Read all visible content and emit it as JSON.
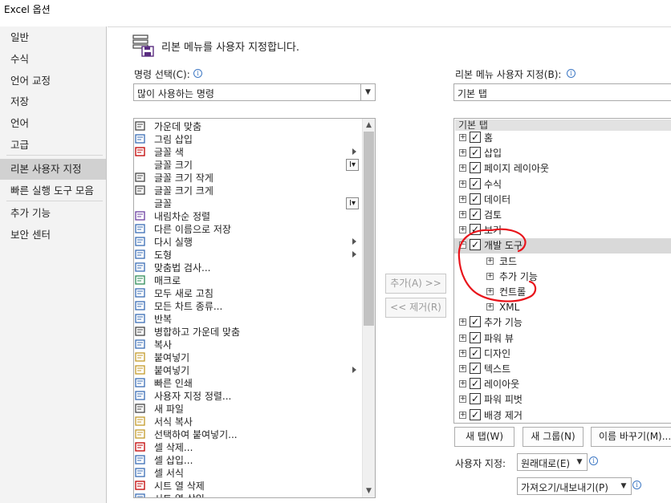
{
  "window": {
    "title": "Excel 옵션"
  },
  "sidebar": {
    "items": [
      {
        "label": "일반"
      },
      {
        "label": "수식"
      },
      {
        "label": "언어 교정"
      },
      {
        "label": "저장"
      },
      {
        "label": "언어"
      },
      {
        "label": "고급"
      },
      {
        "label": "리본 사용자 지정"
      },
      {
        "label": "빠른 실행 도구 모음"
      },
      {
        "label": "추가 기능"
      },
      {
        "label": "보안 센터"
      }
    ],
    "active_index": 6
  },
  "header": {
    "title": "리본 메뉴를 사용자 지정합니다."
  },
  "left": {
    "choose_label": "명령 선택(C):",
    "choose_value": "많이 사용하는 명령",
    "commands": [
      {
        "label": "가운데 맞춤",
        "icon": "center-align-icon"
      },
      {
        "label": "그림 삽입",
        "icon": "picture-icon"
      },
      {
        "label": "글꼴 색",
        "icon": "font-color-icon",
        "arrow": true
      },
      {
        "label": "글꼴 크기",
        "icon": "blank",
        "menu": true
      },
      {
        "label": "글꼴 크기 작게",
        "icon": "font-shrink-icon"
      },
      {
        "label": "글꼴 크기 크게",
        "icon": "font-grow-icon"
      },
      {
        "label": "글꼴",
        "icon": "blank",
        "menu": true
      },
      {
        "label": "내림차순 정렬",
        "icon": "sort-desc-icon"
      },
      {
        "label": "다른 이름으로 저장",
        "icon": "save-as-icon"
      },
      {
        "label": "다시 실행",
        "icon": "redo-icon",
        "arrow": true
      },
      {
        "label": "도형",
        "icon": "shapes-icon",
        "arrow": true
      },
      {
        "label": "맞춤법 검사...",
        "icon": "spelling-icon"
      },
      {
        "label": "매크로",
        "icon": "macro-icon"
      },
      {
        "label": "모두 새로 고침",
        "icon": "refresh-icon"
      },
      {
        "label": "모든 차트 종류...",
        "icon": "chart-icon"
      },
      {
        "label": "반복",
        "icon": "repeat-icon"
      },
      {
        "label": "병합하고 가운데 맞춤",
        "icon": "merge-icon"
      },
      {
        "label": "복사",
        "icon": "copy-icon"
      },
      {
        "label": "붙여넣기",
        "icon": "paste-icon"
      },
      {
        "label": "붙여넣기",
        "icon": "paste-icon",
        "arrow": true
      },
      {
        "label": "빠른 인쇄",
        "icon": "print-icon"
      },
      {
        "label": "사용자 지정 정렬...",
        "icon": "custom-sort-icon"
      },
      {
        "label": "새 파일",
        "icon": "new-file-icon"
      },
      {
        "label": "서식 복사",
        "icon": "format-painter-icon"
      },
      {
        "label": "선택하여 붙여넣기...",
        "icon": "paste-special-icon"
      },
      {
        "label": "셀 삭제...",
        "icon": "delete-cells-icon"
      },
      {
        "label": "셀 삽입...",
        "icon": "insert-cells-icon"
      },
      {
        "label": "셀 서식",
        "icon": "format-cells-icon"
      },
      {
        "label": "시트 열 삭제",
        "icon": "delete-column-icon"
      },
      {
        "label": "시트 열 삽입",
        "icon": "insert-column-icon"
      }
    ]
  },
  "middle": {
    "add_label": "추가(A) >>",
    "remove_label": "<< 제거(R)"
  },
  "right": {
    "customize_label": "리본 메뉴 사용자 지정(B):",
    "customize_value": "기본 탭",
    "tree_header": "기본 탭",
    "tabs": [
      {
        "label": "홈",
        "level": 0,
        "expander": "+",
        "checked": true
      },
      {
        "label": "삽입",
        "level": 0,
        "expander": "+",
        "checked": true
      },
      {
        "label": "페이지 레이아웃",
        "level": 0,
        "expander": "+",
        "checked": true
      },
      {
        "label": "수식",
        "level": 0,
        "expander": "+",
        "checked": true
      },
      {
        "label": "데이터",
        "level": 0,
        "expander": "+",
        "checked": true
      },
      {
        "label": "검토",
        "level": 0,
        "expander": "+",
        "checked": true
      },
      {
        "label": "보기",
        "level": 0,
        "expander": "+",
        "checked": true
      },
      {
        "label": "개발 도구",
        "level": 0,
        "expander": "−",
        "checked": true,
        "selected": true
      },
      {
        "label": "코드",
        "level": 1,
        "expander": "+"
      },
      {
        "label": "추가 기능",
        "level": 1,
        "expander": "+"
      },
      {
        "label": "컨트롤",
        "level": 1,
        "expander": "+"
      },
      {
        "label": "XML",
        "level": 1,
        "expander": "+"
      },
      {
        "label": "추가 기능",
        "level": 0,
        "expander": "+",
        "checked": true
      },
      {
        "label": "파워 뷰",
        "level": 0,
        "expander": "+",
        "checked": true
      },
      {
        "label": "디자인",
        "level": 0,
        "expander": "+",
        "checked": true
      },
      {
        "label": "텍스트",
        "level": 0,
        "expander": "+",
        "checked": true
      },
      {
        "label": "레이아웃",
        "level": 0,
        "expander": "+",
        "checked": true
      },
      {
        "label": "파워 피벗",
        "level": 0,
        "expander": "+",
        "checked": true
      },
      {
        "label": "배경 제거",
        "level": 0,
        "expander": "+",
        "checked": true
      }
    ],
    "new_tab_label": "새 탭(W)",
    "new_group_label": "새 그룹(N)",
    "rename_label": "이름 바꾸기(M)...",
    "customization_label": "사용자 지정:",
    "reset_value": "원래대로(E)",
    "import_export_value": "가져오기/내보내기(P)"
  },
  "colors": {
    "annotation": "#e8141b",
    "selected": "#d9d9d9",
    "nav_active": "#d1d1d1"
  }
}
